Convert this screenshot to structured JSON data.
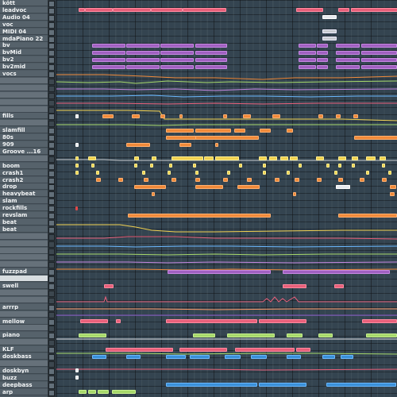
{
  "tracks": [
    {
      "label": "kött",
      "kind": "normal"
    },
    {
      "label": "leadvoc",
      "kind": "normal"
    },
    {
      "label": "Audio 04",
      "kind": "normal"
    },
    {
      "label": "voc",
      "kind": "normal"
    },
    {
      "label": "MIDI 04",
      "kind": "normal"
    },
    {
      "label": "mdaPiano 22",
      "kind": "normal"
    },
    {
      "label": "bv",
      "kind": "normal"
    },
    {
      "label": "bvMid",
      "kind": "normal"
    },
    {
      "label": "bv2",
      "kind": "normal"
    },
    {
      "label": "bv2mid",
      "kind": "normal"
    },
    {
      "label": "vocs",
      "kind": "normal"
    },
    {
      "label": "",
      "kind": "auto"
    },
    {
      "label": "",
      "kind": "auto"
    },
    {
      "label": "",
      "kind": "auto"
    },
    {
      "label": "",
      "kind": "auto"
    },
    {
      "label": "",
      "kind": "auto"
    },
    {
      "label": "fills",
      "kind": "normal"
    },
    {
      "label": "",
      "kind": "auto"
    },
    {
      "label": "slamfill",
      "kind": "normal"
    },
    {
      "label": "80s",
      "kind": "normal"
    },
    {
      "label": "909",
      "kind": "normal"
    },
    {
      "label": "Groove ...16",
      "kind": "normal"
    },
    {
      "label": "",
      "kind": "auto"
    },
    {
      "label": "boom",
      "kind": "normal"
    },
    {
      "label": "crash1",
      "kind": "normal"
    },
    {
      "label": "crash2",
      "kind": "normal"
    },
    {
      "label": "drop",
      "kind": "normal"
    },
    {
      "label": "heavybeat",
      "kind": "normal"
    },
    {
      "label": "slam",
      "kind": "normal"
    },
    {
      "label": "rockfills",
      "kind": "normal"
    },
    {
      "label": "revslam",
      "kind": "normal"
    },
    {
      "label": "beat",
      "kind": "normal"
    },
    {
      "label": "beat",
      "kind": "normal"
    },
    {
      "label": "",
      "kind": "auto"
    },
    {
      "label": "",
      "kind": "auto"
    },
    {
      "label": "",
      "kind": "auto"
    },
    {
      "label": "",
      "kind": "auto"
    },
    {
      "label": "",
      "kind": "auto"
    },
    {
      "label": "fuzzpad",
      "kind": "normal"
    },
    {
      "label": "",
      "kind": "sel"
    },
    {
      "label": "swell",
      "kind": "normal"
    },
    {
      "label": "",
      "kind": "auto"
    },
    {
      "label": "",
      "kind": "auto"
    },
    {
      "label": "arrrp",
      "kind": "normal"
    },
    {
      "label": "",
      "kind": "auto"
    },
    {
      "label": "mellow",
      "kind": "normal"
    },
    {
      "label": "",
      "kind": "auto"
    },
    {
      "label": "piano",
      "kind": "normal"
    },
    {
      "label": "",
      "kind": "auto"
    },
    {
      "label": "KLF",
      "kind": "normal"
    },
    {
      "label": "doskbass",
      "kind": "normal"
    },
    {
      "label": "",
      "kind": "auto"
    },
    {
      "label": "doskbyn",
      "kind": "normal"
    },
    {
      "label": "buzz",
      "kind": "normal"
    },
    {
      "label": "deepbass",
      "kind": "normal"
    },
    {
      "label": "arp",
      "kind": "normal"
    }
  ],
  "clips": [
    {
      "row": 1,
      "color": "pink",
      "segments": [
        [
          28,
          8
        ],
        [
          36,
          35
        ],
        [
          71,
          48
        ],
        [
          119,
          40
        ],
        [
          159,
          55
        ],
        [
          302,
          34
        ],
        [
          355,
          14
        ],
        [
          371,
          60
        ]
      ]
    },
    {
      "row": 2,
      "color": "white",
      "segments": [
        [
          335,
          18
        ]
      ]
    },
    {
      "row": 4,
      "color": "gray",
      "segments": [
        [
          335,
          18
        ]
      ]
    },
    {
      "row": 5,
      "color": "gray",
      "segments": [
        [
          335,
          18
        ]
      ]
    },
    {
      "row": 6,
      "color": "purple",
      "segments": [
        [
          45,
          42
        ],
        [
          88,
          42
        ],
        [
          131,
          42
        ],
        [
          175,
          40
        ],
        [
          305,
          22
        ],
        [
          328,
          14
        ],
        [
          352,
          30
        ],
        [
          384,
          45
        ]
      ]
    },
    {
      "row": 7,
      "color": "purple",
      "segments": [
        [
          45,
          42
        ],
        [
          88,
          42
        ],
        [
          131,
          42
        ],
        [
          175,
          40
        ],
        [
          305,
          22
        ],
        [
          328,
          14
        ],
        [
          352,
          30
        ],
        [
          384,
          45
        ]
      ]
    },
    {
      "row": 8,
      "color": "purple",
      "segments": [
        [
          45,
          42
        ],
        [
          88,
          42
        ],
        [
          131,
          42
        ],
        [
          175,
          40
        ],
        [
          305,
          22
        ],
        [
          328,
          14
        ],
        [
          352,
          30
        ],
        [
          384,
          45
        ]
      ]
    },
    {
      "row": 9,
      "color": "purple",
      "segments": [
        [
          45,
          42
        ],
        [
          88,
          42
        ],
        [
          131,
          42
        ],
        [
          175,
          40
        ],
        [
          305,
          22
        ],
        [
          328,
          14
        ],
        [
          352,
          30
        ],
        [
          384,
          45
        ]
      ]
    },
    {
      "row": 16,
      "color": "orange",
      "segments": [
        [
          24,
          4
        ],
        [
          58,
          14
        ],
        [
          95,
          10
        ],
        [
          131,
          6
        ],
        [
          155,
          4
        ],
        [
          210,
          5
        ],
        [
          235,
          10
        ],
        [
          272,
          10
        ],
        [
          330,
          6
        ],
        [
          352,
          6
        ],
        [
          374,
          6
        ]
      ]
    },
    {
      "row": 16,
      "color": "white",
      "segments": [
        [
          24,
          4
        ]
      ]
    },
    {
      "row": 18,
      "color": "orange",
      "segments": [
        [
          138,
          35
        ],
        [
          175,
          45
        ],
        [
          224,
          14
        ],
        [
          256,
          14
        ],
        [
          290,
          8
        ]
      ]
    },
    {
      "row": 19,
      "color": "orange",
      "segments": [
        [
          138,
          38
        ],
        [
          175,
          80
        ],
        [
          375,
          55
        ]
      ]
    },
    {
      "row": 20,
      "color": "white",
      "segments": [
        [
          24,
          4
        ]
      ]
    },
    {
      "row": 20,
      "color": "orange",
      "segments": [
        [
          88,
          30
        ],
        [
          155,
          15
        ],
        [
          200,
          4
        ]
      ]
    },
    {
      "row": 22,
      "color": "yellow",
      "segments": [
        [
          24,
          4
        ],
        [
          40,
          10
        ],
        [
          98,
          6
        ],
        [
          120,
          6
        ],
        [
          145,
          40
        ],
        [
          186,
          12
        ],
        [
          200,
          30
        ],
        [
          255,
          10
        ],
        [
          268,
          10
        ],
        [
          282,
          10
        ],
        [
          294,
          10
        ],
        [
          327,
          10
        ],
        [
          355,
          10
        ],
        [
          372,
          8
        ],
        [
          390,
          12
        ],
        [
          407,
          8
        ]
      ]
    },
    {
      "row": 23,
      "color": "yellow",
      "segments": [
        [
          24,
          4
        ],
        [
          44,
          4
        ],
        [
          98,
          4
        ],
        [
          118,
          4
        ],
        [
          142,
          4
        ],
        [
          172,
          4
        ],
        [
          230,
          4
        ],
        [
          260,
          4
        ],
        [
          305,
          4
        ],
        [
          340,
          4
        ],
        [
          355,
          4
        ],
        [
          372,
          4
        ],
        [
          410,
          4
        ]
      ]
    },
    {
      "row": 24,
      "color": "yellow",
      "segments": [
        [
          24,
          4
        ],
        [
          50,
          4
        ],
        [
          108,
          4
        ],
        [
          140,
          4
        ],
        [
          175,
          4
        ],
        [
          215,
          4
        ],
        [
          260,
          4
        ],
        [
          290,
          4
        ],
        [
          350,
          4
        ],
        [
          390,
          4
        ],
        [
          418,
          4
        ]
      ]
    },
    {
      "row": 25,
      "color": "orange",
      "segments": [
        [
          50,
          6
        ],
        [
          78,
          6
        ],
        [
          110,
          6
        ],
        [
          145,
          6
        ],
        [
          175,
          6
        ],
        [
          210,
          6
        ],
        [
          240,
          6
        ],
        [
          275,
          6
        ],
        [
          300,
          6
        ],
        [
          328,
          6
        ],
        [
          355,
          6
        ],
        [
          382,
          6
        ],
        [
          410,
          6
        ]
      ]
    },
    {
      "row": 26,
      "color": "orange",
      "segments": [
        [
          98,
          40
        ],
        [
          175,
          35
        ],
        [
          228,
          28
        ],
        [
          352,
          18
        ],
        [
          420,
          8
        ]
      ]
    },
    {
      "row": 26,
      "color": "white",
      "segments": [
        [
          352,
          18
        ]
      ]
    },
    {
      "row": 27,
      "color": "orange",
      "segments": [
        [
          120,
          4
        ],
        [
          298,
          4
        ],
        [
          420,
          6
        ]
      ]
    },
    {
      "row": 29,
      "color": "red",
      "segments": [
        [
          24,
          3
        ]
      ]
    },
    {
      "row": 30,
      "color": "orange",
      "segments": [
        [
          90,
          180
        ],
        [
          355,
          74
        ]
      ]
    },
    {
      "row": 38,
      "color": "purple",
      "segments": [
        [
          140,
          130
        ],
        [
          285,
          135
        ]
      ]
    },
    {
      "row": 40,
      "color": "pink",
      "segments": [
        [
          60,
          12
        ],
        [
          285,
          30
        ],
        [
          350,
          12
        ]
      ]
    },
    {
      "row": 45,
      "color": "pink",
      "segments": [
        [
          30,
          35
        ],
        [
          75,
          6
        ],
        [
          138,
          115
        ],
        [
          255,
          60
        ],
        [
          385,
          44
        ]
      ]
    },
    {
      "row": 47,
      "color": "green",
      "segments": [
        [
          28,
          35
        ],
        [
          172,
          28
        ],
        [
          215,
          60
        ],
        [
          290,
          20
        ],
        [
          330,
          18
        ],
        [
          390,
          39
        ]
      ]
    },
    {
      "row": 49,
      "color": "pink",
      "segments": [
        [
          62,
          85
        ],
        [
          155,
          60
        ],
        [
          225,
          75
        ],
        [
          302,
          18
        ]
      ]
    },
    {
      "row": 50,
      "color": "blue",
      "segments": [
        [
          45,
          18
        ],
        [
          88,
          18
        ],
        [
          138,
          25
        ],
        [
          168,
          25
        ],
        [
          212,
          20
        ],
        [
          245,
          20
        ],
        [
          290,
          18
        ],
        [
          335,
          16
        ],
        [
          358,
          16
        ]
      ]
    },
    {
      "row": 52,
      "color": "white",
      "segments": [
        [
          24,
          4
        ]
      ]
    },
    {
      "row": 53,
      "color": "white",
      "segments": [
        [
          24,
          4
        ]
      ]
    },
    {
      "row": 54,
      "color": "blue",
      "segments": [
        [
          138,
          115
        ],
        [
          255,
          60
        ],
        [
          340,
          88
        ]
      ]
    },
    {
      "row": 55,
      "color": "green",
      "segments": [
        [
          28,
          10
        ],
        [
          40,
          10
        ],
        [
          52,
          14
        ],
        [
          70,
          30
        ]
      ]
    }
  ]
}
